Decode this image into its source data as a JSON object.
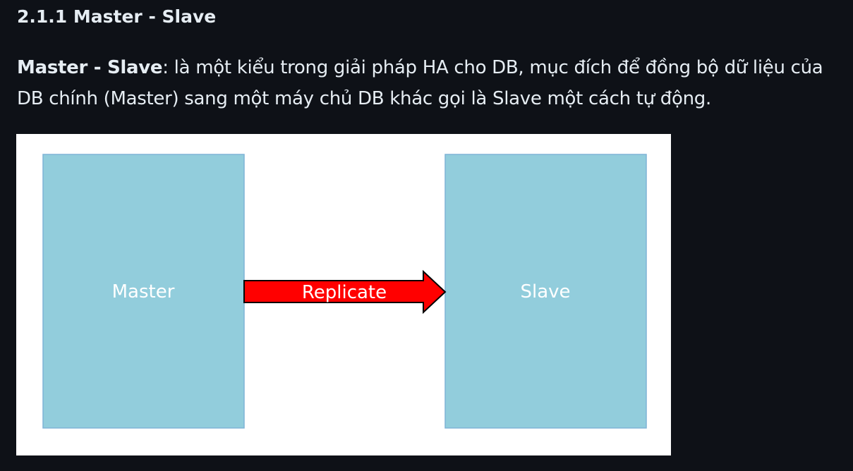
{
  "section": {
    "heading": "2.1.1 Master - Slave"
  },
  "paragraph": {
    "term": "Master - Slave",
    "text": ": là một kiểu trong giải pháp HA cho DB, mục đích để đồng bộ dữ liệu của DB chính (Master) sang một máy chủ DB khác gọi là Slave một cách tự động."
  },
  "diagram": {
    "left_box_label": "Master",
    "right_box_label": "Slave",
    "arrow_label": "Replicate",
    "colors": {
      "box_fill": "#92cddc",
      "box_border": "#7eb3d6",
      "arrow_fill": "#ff0000",
      "label_color": "#ffffff"
    }
  }
}
